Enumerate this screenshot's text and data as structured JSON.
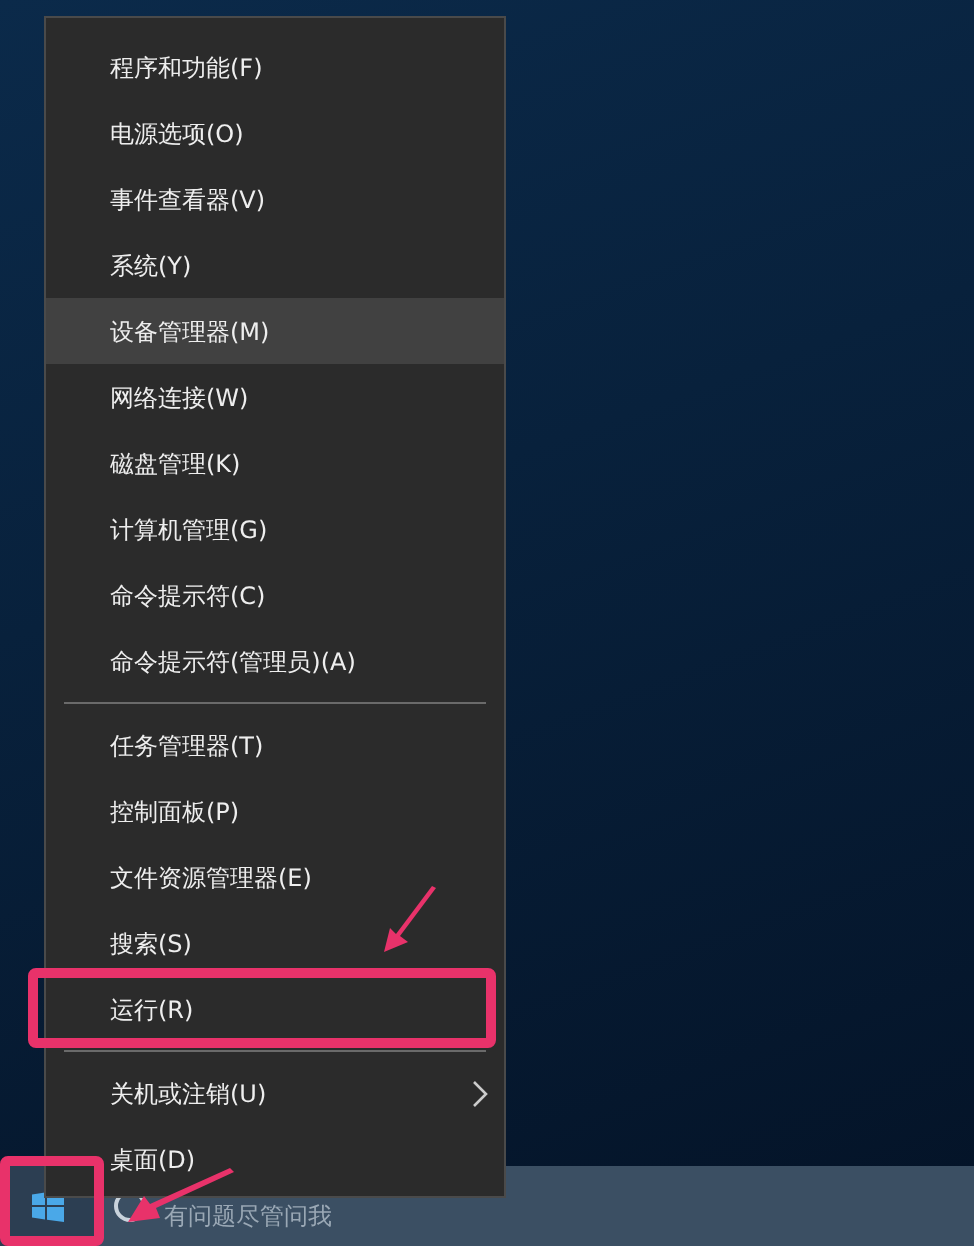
{
  "menu": {
    "groups": [
      {
        "items": [
          {
            "label": "程序和功能(F)",
            "selected": false,
            "submenu": false
          },
          {
            "label": "电源选项(O)",
            "selected": false,
            "submenu": false
          },
          {
            "label": "事件查看器(V)",
            "selected": false,
            "submenu": false
          },
          {
            "label": "系统(Y)",
            "selected": false,
            "submenu": false
          },
          {
            "label": "设备管理器(M)",
            "selected": true,
            "submenu": false
          },
          {
            "label": "网络连接(W)",
            "selected": false,
            "submenu": false
          },
          {
            "label": "磁盘管理(K)",
            "selected": false,
            "submenu": false
          },
          {
            "label": "计算机管理(G)",
            "selected": false,
            "submenu": false
          },
          {
            "label": "命令提示符(C)",
            "selected": false,
            "submenu": false
          },
          {
            "label": "命令提示符(管理员)(A)",
            "selected": false,
            "submenu": false
          }
        ]
      },
      {
        "items": [
          {
            "label": "任务管理器(T)",
            "selected": false,
            "submenu": false
          },
          {
            "label": "控制面板(P)",
            "selected": false,
            "submenu": false
          },
          {
            "label": "文件资源管理器(E)",
            "selected": false,
            "submenu": false
          },
          {
            "label": "搜索(S)",
            "selected": false,
            "submenu": false
          },
          {
            "label": "运行(R)",
            "selected": false,
            "submenu": false
          }
        ]
      },
      {
        "items": [
          {
            "label": "关机或注销(U)",
            "selected": false,
            "submenu": true
          },
          {
            "label": "桌面(D)",
            "selected": false,
            "submenu": false
          }
        ]
      }
    ]
  },
  "taskbar": {
    "search": {
      "placeholder": "有问题尽管问我"
    }
  }
}
